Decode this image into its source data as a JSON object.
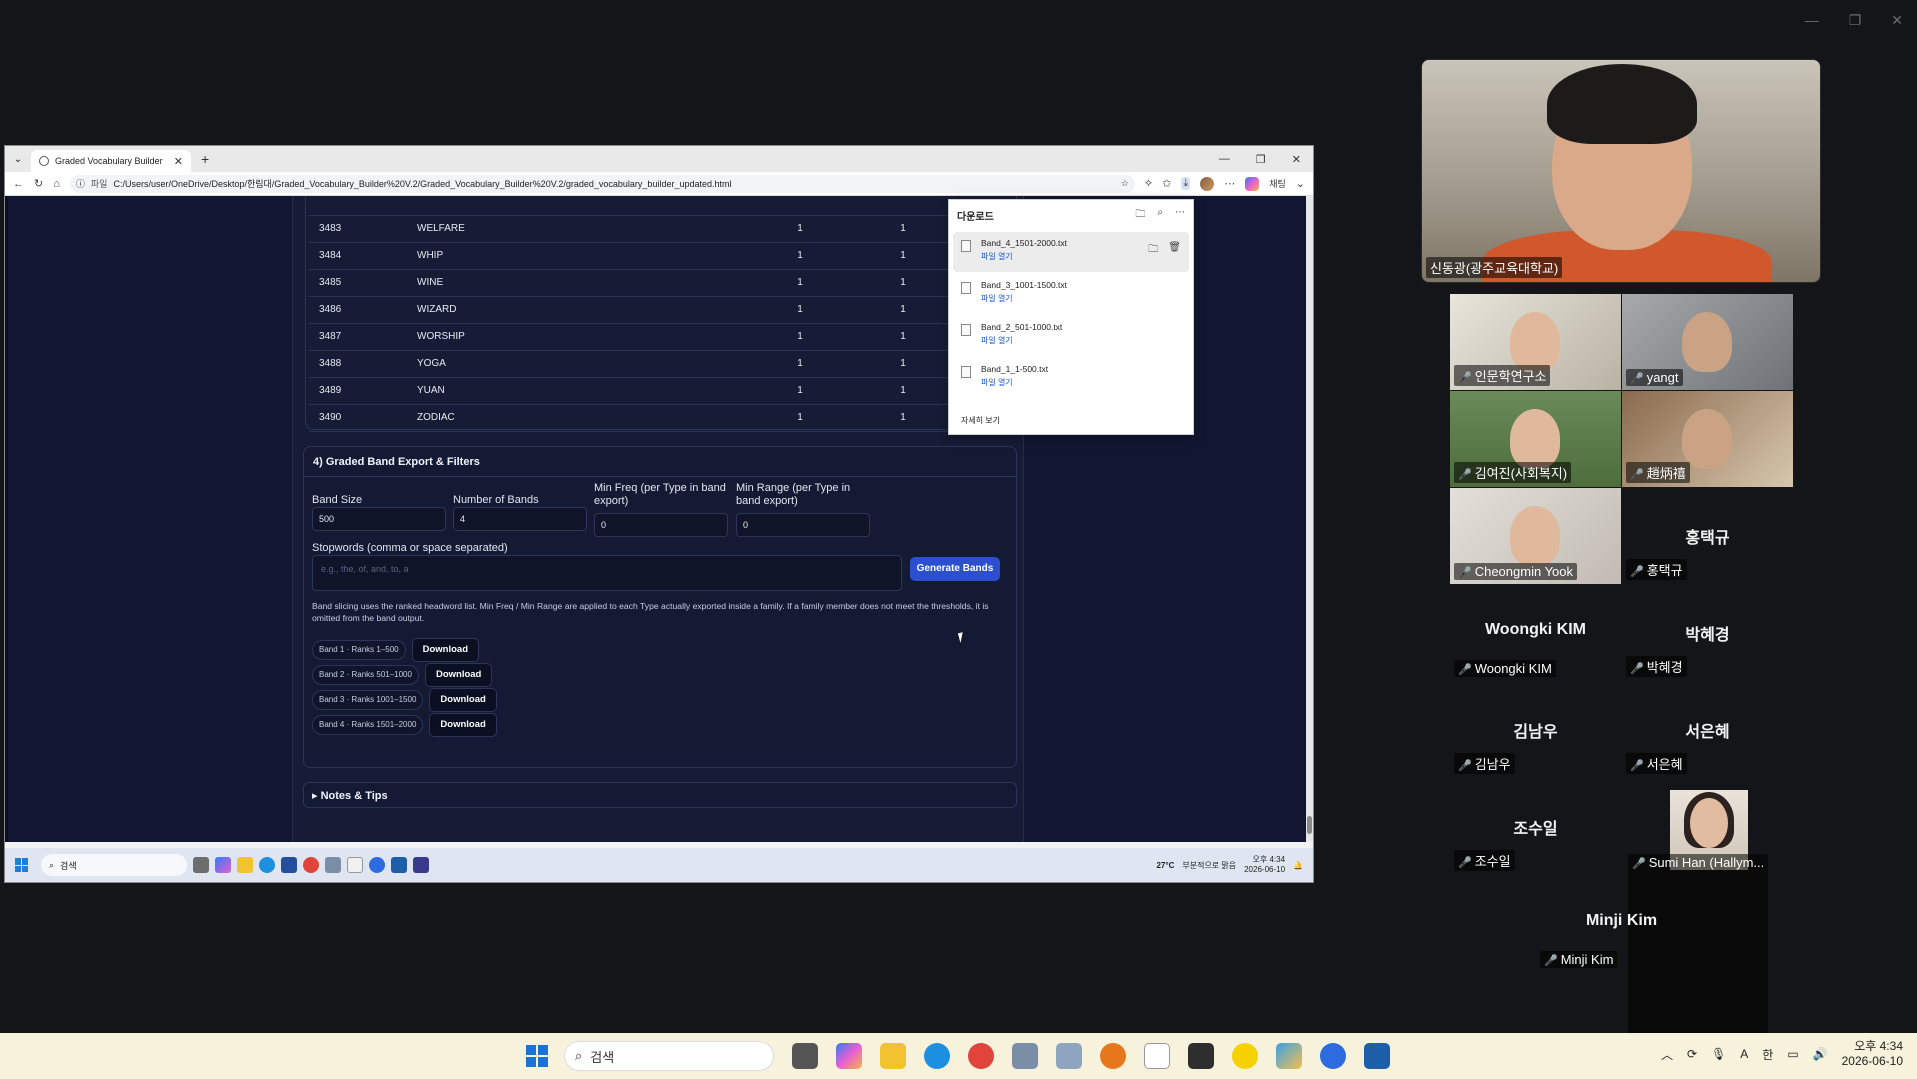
{
  "browser": {
    "tab_title": "Graded Vocabulary Builder",
    "url_label": "파일",
    "url": "C:/Users/user/OneDrive/Desktop/한림대/Graded_Vocabulary_Builder%20V.2/Graded_Vocabulary_Builder%20V.2/graded_vocabulary_builder_updated.html",
    "chat_label": "채팅"
  },
  "table": {
    "rows": [
      {
        "rank": "3483",
        "word": "WELFARE",
        "a": "1",
        "b": "1"
      },
      {
        "rank": "3484",
        "word": "WHIP",
        "a": "1",
        "b": "1"
      },
      {
        "rank": "3485",
        "word": "WINE",
        "a": "1",
        "b": "1"
      },
      {
        "rank": "3486",
        "word": "WIZARD",
        "a": "1",
        "b": "1"
      },
      {
        "rank": "3487",
        "word": "WORSHIP",
        "a": "1",
        "b": "1"
      },
      {
        "rank": "3488",
        "word": "YOGA",
        "a": "1",
        "b": "1"
      },
      {
        "rank": "3489",
        "word": "YUAN",
        "a": "1",
        "b": "1"
      },
      {
        "rank": "3490",
        "word": "ZODIAC",
        "a": "1",
        "b": "1"
      }
    ]
  },
  "export": {
    "title": "4) Graded Band Export & Filters",
    "band_size_label": "Band Size",
    "band_size": "500",
    "num_bands_label": "Number of Bands",
    "num_bands": "4",
    "min_freq_label": "Min Freq (per Type in band export)",
    "min_freq": "0",
    "min_range_label": "Min Range (per Type in band export)",
    "min_range": "0",
    "stopwords_label": "Stopwords (comma or space separated)",
    "stopwords_placeholder": "e.g., the, of, and, to, a",
    "generate_label": "Generate Bands",
    "note": "Band slicing uses the ranked headword list. Min Freq / Min Range are applied to each Type actually exported inside a family. If a family member does not meet the thresholds, it is omitted from the band output.",
    "bands": [
      {
        "label": "Band 1 · Ranks 1–500",
        "button": "Download"
      },
      {
        "label": "Band 2 · Ranks 501–1000",
        "button": "Download"
      },
      {
        "label": "Band 3 · Ranks 1001–1500",
        "button": "Download"
      },
      {
        "label": "Band 4 · Ranks 1501–2000",
        "button": "Download"
      }
    ],
    "notes_tips": "▸ Notes & Tips"
  },
  "downloads": {
    "title": "다운로드",
    "items": [
      {
        "name": "Band_4_1501-2000.txt",
        "open": "파일 열기"
      },
      {
        "name": "Band_3_1001-1500.txt",
        "open": "파일 열기"
      },
      {
        "name": "Band_2_501-1000.txt",
        "open": "파일 열기"
      },
      {
        "name": "Band_1_1-500.txt",
        "open": "파일 열기"
      }
    ],
    "more": "자세히 보기"
  },
  "inner_taskbar": {
    "search": "검색",
    "weather": "27°C",
    "weather_sub": "부분적으로 맑음",
    "time": "오후 4:34",
    "date": "2026-06-10"
  },
  "zoom": {
    "speaker": "신동광(광주교육대학교)",
    "tiles": [
      "인문학연구소",
      "yangt",
      "김여진(사회복지)",
      "趙炳禧",
      "Cheongmin Yook"
    ],
    "nocam": [
      {
        "big": "홍택규",
        "name": "홍택규"
      },
      {
        "big": "Woongki KIM",
        "name": "Woongki KIM"
      },
      {
        "big": "박혜경",
        "name": "박혜경"
      },
      {
        "big": "김남우",
        "name": "김남우"
      },
      {
        "big": "서은혜",
        "name": "서은혜"
      },
      {
        "big": "조수일",
        "name": "조수일"
      },
      {
        "big": "Minji Kim",
        "name": "Minji Kim"
      }
    ],
    "avatar_name": "Sumi Han (Hallym..."
  },
  "os_taskbar": {
    "search": "검색",
    "ime": "한",
    "ime2": "A",
    "time": "오후 4:34",
    "date": "2026-06-10"
  }
}
